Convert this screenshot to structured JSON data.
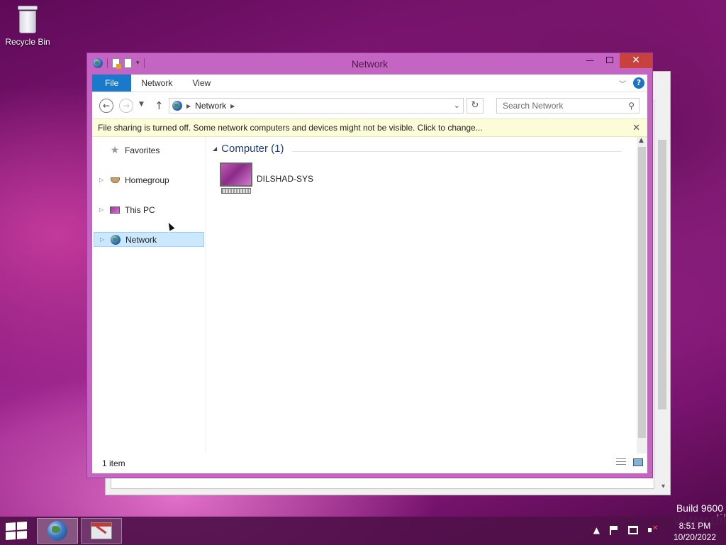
{
  "desktop": {
    "recycle_bin_label": "Recycle Bin",
    "build_text": "Build 9600",
    "watermark": "www.dilsh"
  },
  "window": {
    "title": "Network",
    "ribbon_tabs": [
      "File",
      "Network",
      "View"
    ],
    "address_path": "Network",
    "search_placeholder": "Search Network",
    "info_bar_text": "File sharing is turned off. Some network computers and devices might not be visible. Click to change...",
    "help_label": "?"
  },
  "nav_pane": {
    "items": [
      {
        "label": "Favorites",
        "icon": "star-icon"
      },
      {
        "label": "Homegroup",
        "icon": "homegroup-icon"
      },
      {
        "label": "This PC",
        "icon": "computer-icon"
      },
      {
        "label": "Network",
        "icon": "network-globe-icon",
        "selected": true
      }
    ]
  },
  "content": {
    "group_header": "Computer (1)",
    "items": [
      {
        "label": "DILSHAD-SYS",
        "icon": "computer-icon"
      }
    ]
  },
  "status_bar": {
    "item_count": "1 item"
  },
  "taskbar": {
    "pinned": [
      "file-explorer-network",
      "app"
    ],
    "clock_time": "8:51 PM",
    "clock_date": "10/20/2022"
  },
  "colors": {
    "accent": "#1979ca",
    "window_frame": "#c565c3",
    "selection": "#cce8ff",
    "info_bar": "#fdfcd9"
  }
}
